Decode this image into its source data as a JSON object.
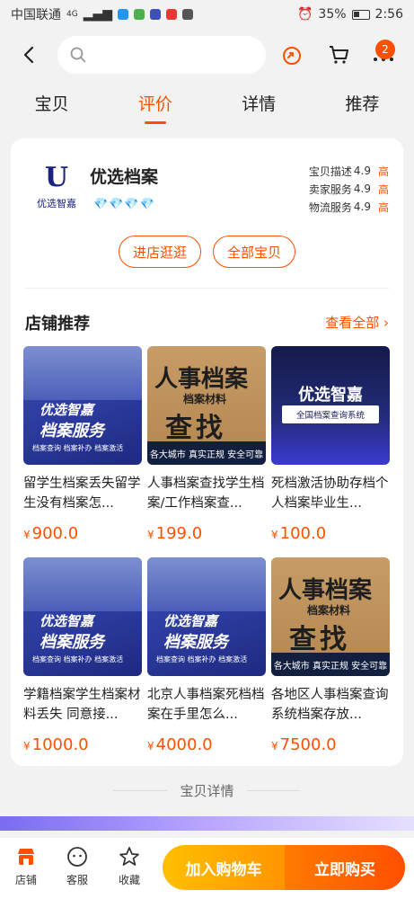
{
  "status_bar": {
    "carrier": "中国联通",
    "network": "4G",
    "battery": "35%",
    "time": "2:56"
  },
  "header": {
    "search_placeholder": "",
    "cart_badge": "2"
  },
  "tabs": [
    {
      "label": "宝贝",
      "active": false
    },
    {
      "label": "评价",
      "active": true
    },
    {
      "label": "详情",
      "active": false
    },
    {
      "label": "推荐",
      "active": false
    }
  ],
  "shop": {
    "logo_letter": "U",
    "logo_text": "优选智嘉",
    "name": "优选档案",
    "diamonds": "💎💎💎💎",
    "ratings": [
      {
        "label": "宝贝描述",
        "score": "4.9",
        "level": "高"
      },
      {
        "label": "卖家服务",
        "score": "4.9",
        "level": "高"
      },
      {
        "label": "物流服务",
        "score": "4.9",
        "level": "高"
      }
    ],
    "enter_store": "进店逛逛",
    "all_items": "全部宝贝"
  },
  "recommend": {
    "title": "店铺推荐",
    "more": "查看全部"
  },
  "products": [
    {
      "title": "留学生档案丢失留学生没有档案怎...",
      "price": "900.0",
      "thumb": {
        "type": "blue",
        "line1": "优选智嘉",
        "line2": "档案服务",
        "line3": "档案查询 档案补办 档案激活"
      }
    },
    {
      "title": "人事档案查找学生档案/工作档案查...",
      "price": "199.0",
      "thumb": {
        "type": "tan",
        "big": "人事档案",
        "mid": "档案材料",
        "find": "查找",
        "bar": "各大城市 真实正规 安全可靠"
      }
    },
    {
      "title": "死档激活协助存档个人档案毕业生...",
      "price": "100.0",
      "thumb": {
        "type": "dark",
        "line1": "优选智嘉",
        "line2": "全国档案查询系统"
      }
    },
    {
      "title": "学籍档案学生档案材料丢失 同意接...",
      "price": "1000.0",
      "thumb": {
        "type": "blue",
        "line1": "优选智嘉",
        "line2": "档案服务",
        "line3": "档案查询 档案补办 档案激活"
      }
    },
    {
      "title": "北京人事档案死档档案在手里怎么...",
      "price": "4000.0",
      "thumb": {
        "type": "blue",
        "line1": "优选智嘉",
        "line2": "档案服务",
        "line3": "档案查询 档案补办 档案激活"
      }
    },
    {
      "title": "各地区人事档案查询系统档案存放...",
      "price": "7500.0",
      "thumb": {
        "type": "tan",
        "big": "人事档案",
        "mid": "档案材料",
        "find": "查找",
        "bar": "各大城市 真实正规 安全可靠"
      }
    }
  ],
  "currency_symbol": "¥",
  "details_separator": "宝贝详情",
  "bottom_bar": {
    "store": "店铺",
    "service": "客服",
    "favorite": "收藏",
    "add_to_cart": "加入购物车",
    "buy_now": "立即购买"
  },
  "colors": {
    "accent": "#ff5000",
    "cart_button": "#ffa500",
    "buy_button": "#ff5000"
  }
}
